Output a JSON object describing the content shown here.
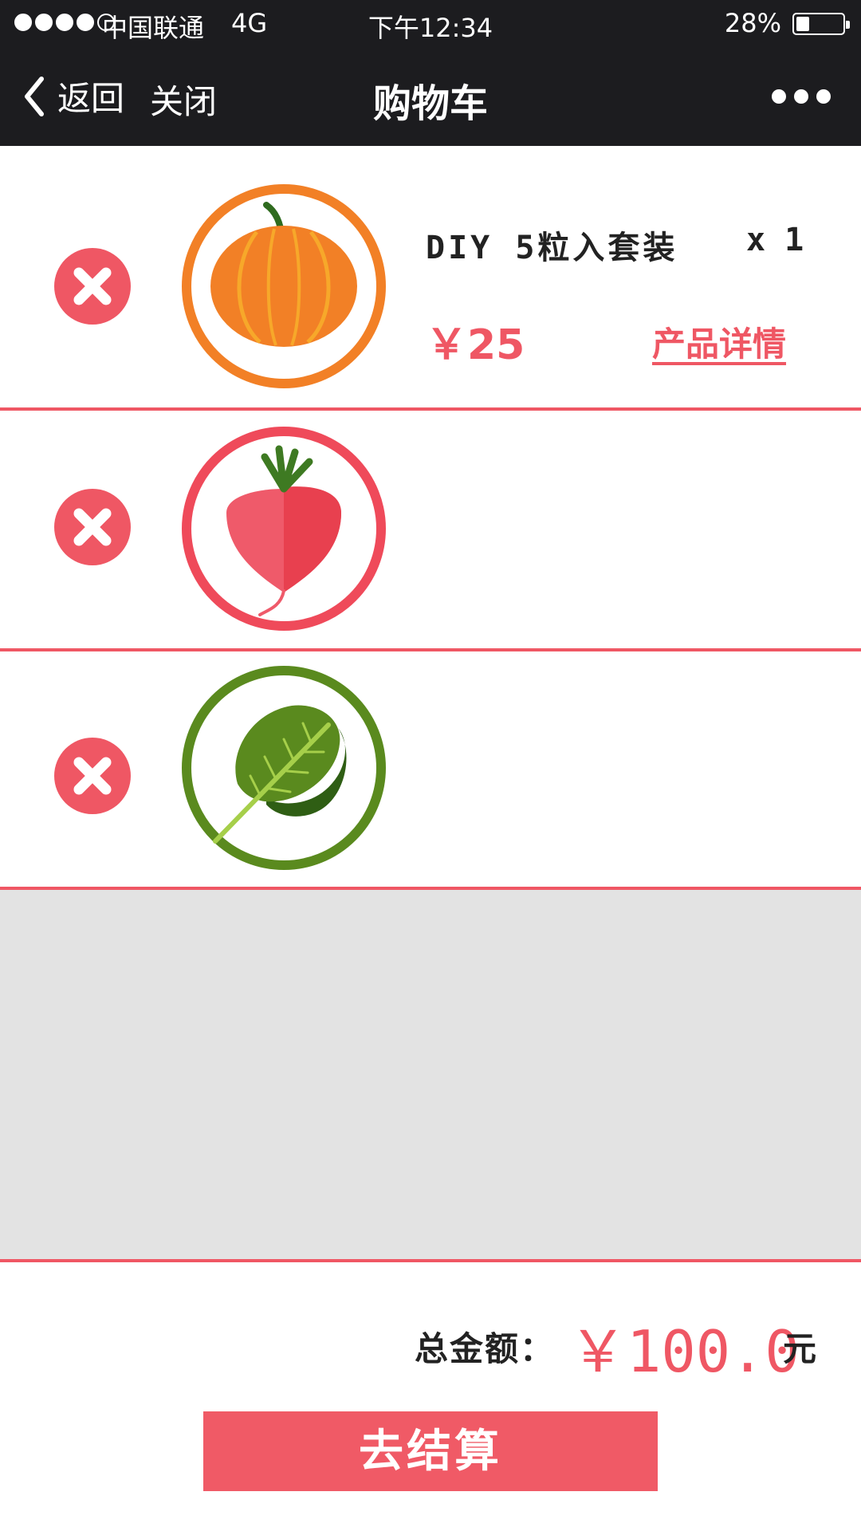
{
  "status_bar": {
    "carrier": "中国联通",
    "network": "4G",
    "time": "下午12:34",
    "battery": "28%",
    "battery_level": 0.28,
    "signal_dots": 5,
    "signal_filled": 4
  },
  "nav": {
    "back_label": "返回",
    "close_label": "关闭",
    "title": "购物车",
    "back_icon": "chevron-left-icon",
    "more_icon": "more-dots-icon"
  },
  "cart": {
    "items": [
      {
        "icon": "pumpkin-icon",
        "color": "#f28026",
        "name": "DIY 5粒入套装",
        "qty": "x 1",
        "price": "￥25",
        "detail_link": "产品详情"
      },
      {
        "icon": "radish-icon",
        "color": "#ef4a5a"
      },
      {
        "icon": "leafy-greens-icon",
        "color": "#5a8a1e"
      }
    ]
  },
  "summary": {
    "total_label": "总金额：",
    "total_amount": "￥100.0",
    "total_unit": "元",
    "checkout_label": "去结算"
  },
  "colors": {
    "accent": "#ef5764",
    "bar": "#1c1c1f",
    "empty_area": "#e3e3e3"
  }
}
